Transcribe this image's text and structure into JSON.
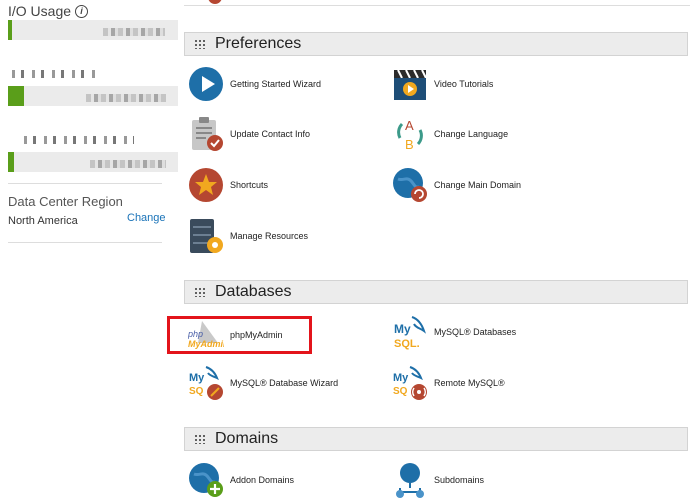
{
  "sidebar": {
    "io_usage_title": "I/O Usage",
    "data_center": {
      "title": "Data Center Region",
      "value": "North America",
      "change_label": "Change"
    }
  },
  "sections": {
    "preferences": {
      "title": "Preferences",
      "items": [
        {
          "label": "Getting Started Wizard",
          "icon": "play-icon"
        },
        {
          "label": "Video Tutorials",
          "icon": "clapperboard-icon"
        },
        {
          "label": "Update Contact Info",
          "icon": "clipboard-icon"
        },
        {
          "label": "Change Language",
          "icon": "language-icon"
        },
        {
          "label": "Shortcuts",
          "icon": "star-icon"
        },
        {
          "label": "Change Main Domain",
          "icon": "globe-refresh-icon"
        },
        {
          "label": "Manage Resources",
          "icon": "server-gear-icon"
        }
      ]
    },
    "databases": {
      "title": "Databases",
      "items": [
        {
          "label": "phpMyAdmin",
          "icon": "phpmyadmin-logo-icon"
        },
        {
          "label": "MySQL® Databases",
          "icon": "mysql-logo-icon"
        },
        {
          "label": "MySQL® Database Wizard",
          "icon": "mysql-wizard-icon"
        },
        {
          "label": "Remote MySQL®",
          "icon": "mysql-remote-icon"
        }
      ]
    },
    "domains": {
      "title": "Domains",
      "items": [
        {
          "label": "Addon Domains",
          "icon": "globe-add-icon"
        },
        {
          "label": "Subdomains",
          "icon": "subdomain-icon"
        }
      ]
    }
  },
  "icon_logo_text": {
    "php_a": "php",
    "php_b": "MyAdmin",
    "mysql_a": "My",
    "mysql_b": "SQL.",
    "mysql_short_b": "SQ",
    "lang_a": "A",
    "lang_b": "B"
  },
  "colors": {
    "accent_blue": "#1e6fa8",
    "brand_red": "#b54731",
    "usage_green": "#5a9e1a",
    "highlight_red": "#e3141b",
    "link": "#1a73b8"
  }
}
